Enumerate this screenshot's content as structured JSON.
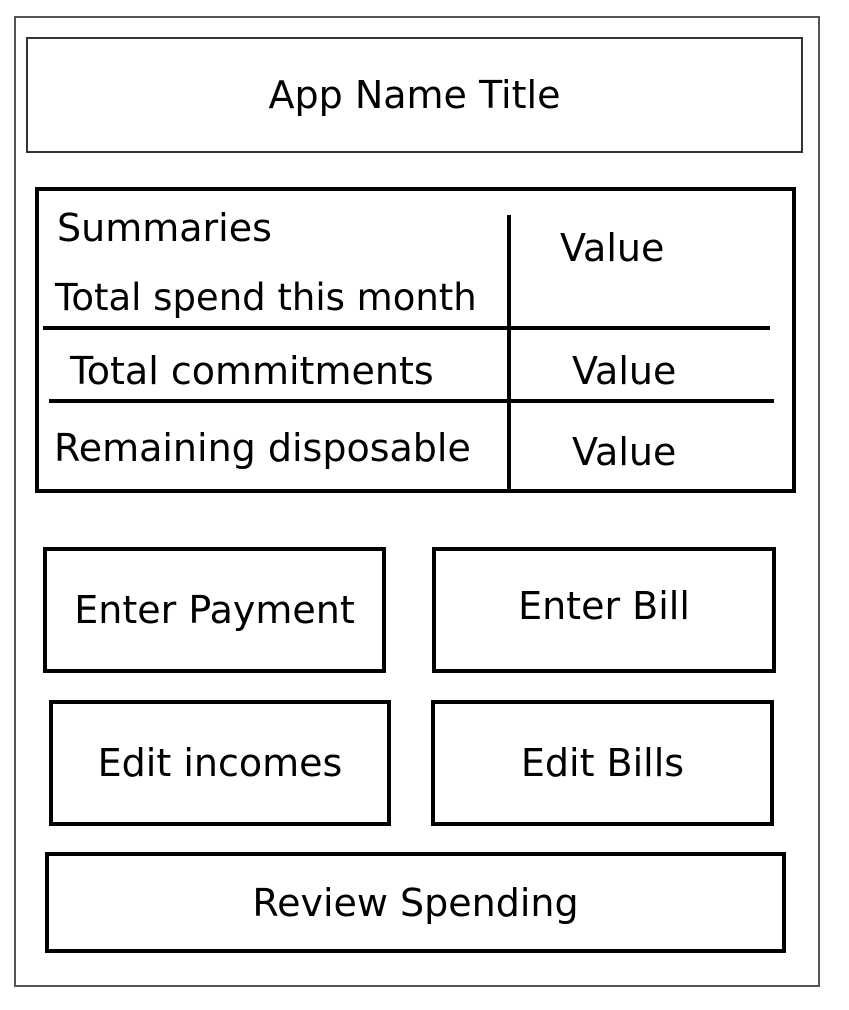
{
  "app": {
    "title": "App Name Title"
  },
  "summary": {
    "header": "Summaries",
    "rows": [
      {
        "label": "Total spend this month",
        "value": "Value"
      },
      {
        "label": "Total commitments",
        "value": "Value"
      },
      {
        "label": "Remaining disposable",
        "value": "Value"
      }
    ]
  },
  "buttons": {
    "enter_payment": "Enter Payment",
    "enter_bill": "Enter Bill",
    "edit_incomes": "Edit incomes",
    "edit_bills": "Edit Bills",
    "review_spending": "Review Spending"
  }
}
